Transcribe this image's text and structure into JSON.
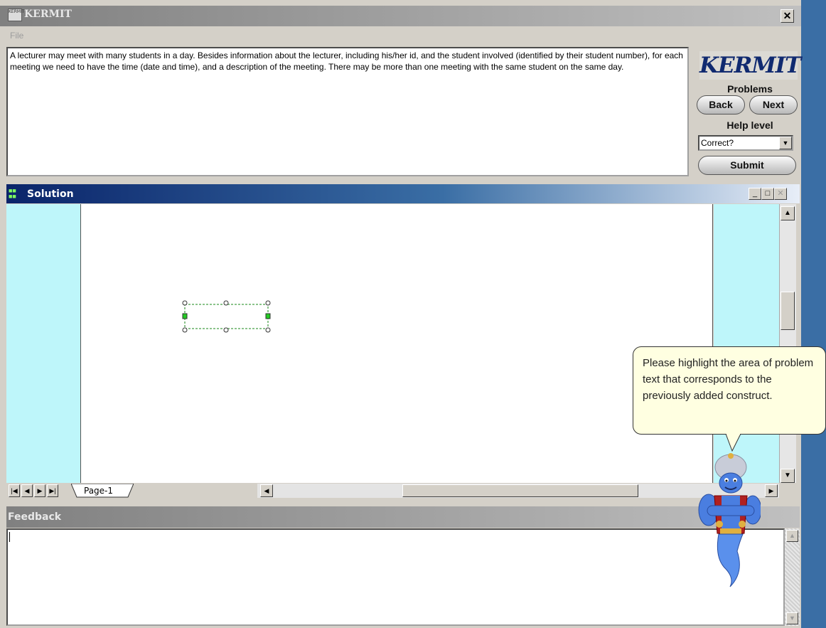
{
  "window": {
    "title": "KERMIT",
    "icon": "app-icon",
    "icon_text": "KERMIT",
    "close_glyph": "✕"
  },
  "menu": {
    "file": "File"
  },
  "problem": {
    "text": "A lecturer may meet with many students in a day. Besides information about the lecturer, including his/her id, and the student involved (identified by their student number), for each meeting we need to have the time (date and time), and a description of the meeting. There may be more than one meeting with the same student on the same day."
  },
  "side_panel": {
    "logo_text": "KERMIT",
    "problems_label": "Problems",
    "back_label": "Back",
    "next_label": "Next",
    "help_level_label": "Help level",
    "help_level_value": "Correct?",
    "submit_label": "Submit"
  },
  "solution": {
    "title": "Solution",
    "icon": "diagram-icon",
    "page_tab": "Page-1",
    "nav_icons": [
      "first-page-icon",
      "prev-page-icon",
      "next-page-icon",
      "last-page-icon"
    ]
  },
  "feedback": {
    "title": "Feedback",
    "text": ""
  },
  "agent": {
    "icon": "genie-icon",
    "message": "Please highlight the area of problem text that corresponds to the previously added construct."
  },
  "colors": {
    "desktop": "#3a6ea5",
    "canvas_margin": "#bef6fa",
    "tooltip": "#ffffe1",
    "handle": "#22cc22"
  }
}
